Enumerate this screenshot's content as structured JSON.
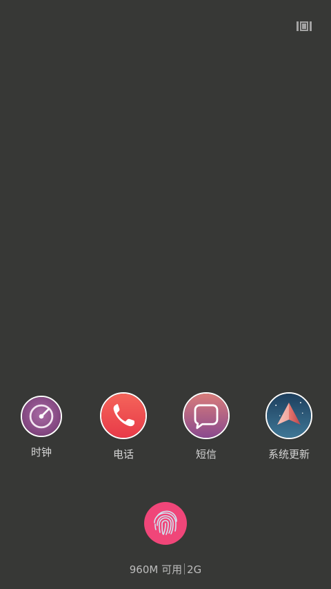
{
  "top_bar": {
    "menu_icon": "task-manager-icon"
  },
  "apps": [
    {
      "label": "时钟",
      "icon": "clock-icon"
    },
    {
      "label": "电话",
      "icon": "phone-icon"
    },
    {
      "label": "短信",
      "icon": "message-icon"
    },
    {
      "label": "系统更新",
      "icon": "system-update-icon"
    }
  ],
  "fingerprint": {
    "icon": "fingerprint-icon",
    "color": "#f04679"
  },
  "memory_status": {
    "available": "960M 可用",
    "total": "2G"
  },
  "colors": {
    "background": "#373836",
    "clock": "#8e4f8c",
    "phone": "#f0504b",
    "message": "#a45f83",
    "update": "#2d4f6e"
  }
}
